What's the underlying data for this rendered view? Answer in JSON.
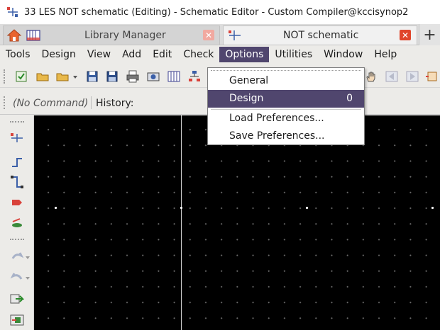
{
  "window": {
    "title": "33 LES NOT schematic (Editing) - Schematic Editor - Custom Compiler@kccisynop2"
  },
  "tabs": [
    {
      "label": "Library Manager",
      "close": "✕"
    },
    {
      "label": "NOT schematic",
      "close": "✕"
    }
  ],
  "new_tab_label": "+",
  "menubar": {
    "items": [
      "Tools",
      "Design",
      "View",
      "Add",
      "Edit",
      "Check",
      "Options",
      "Utilities",
      "Window",
      "Help"
    ],
    "active": "Options"
  },
  "options_menu": {
    "items": [
      {
        "label": "General",
        "shortcut": ""
      },
      {
        "label": "Design",
        "shortcut": "0"
      },
      {
        "label": "Load Preferences...",
        "shortcut": ""
      },
      {
        "label": "Save Preferences...",
        "shortcut": ""
      }
    ],
    "highlighted": "Design"
  },
  "command_bar": {
    "command": "(No Command)",
    "history_label": "History:"
  },
  "colors": {
    "accent": "#50466e",
    "canvas_bg": "#000000",
    "close_active": "#e0452b"
  },
  "toolbar_icons": [
    "design-check-icon",
    "open-folder-icon",
    "open-folder-dropdown-icon",
    "save-icon",
    "save-all-icon",
    "print-icon",
    "snapshot-icon",
    "library-icon",
    "hierarchy-icon",
    "pan-hand-icon",
    "back-icon",
    "forward-icon",
    "pin-icon"
  ],
  "left_toolbar_icons": [
    "add-instance-icon",
    "add-wire-icon",
    "add-pin-icon",
    "add-net-label-icon",
    "stretch-icon",
    "undo-icon",
    "redo-icon",
    "push-in-icon",
    "pop-out-icon"
  ]
}
